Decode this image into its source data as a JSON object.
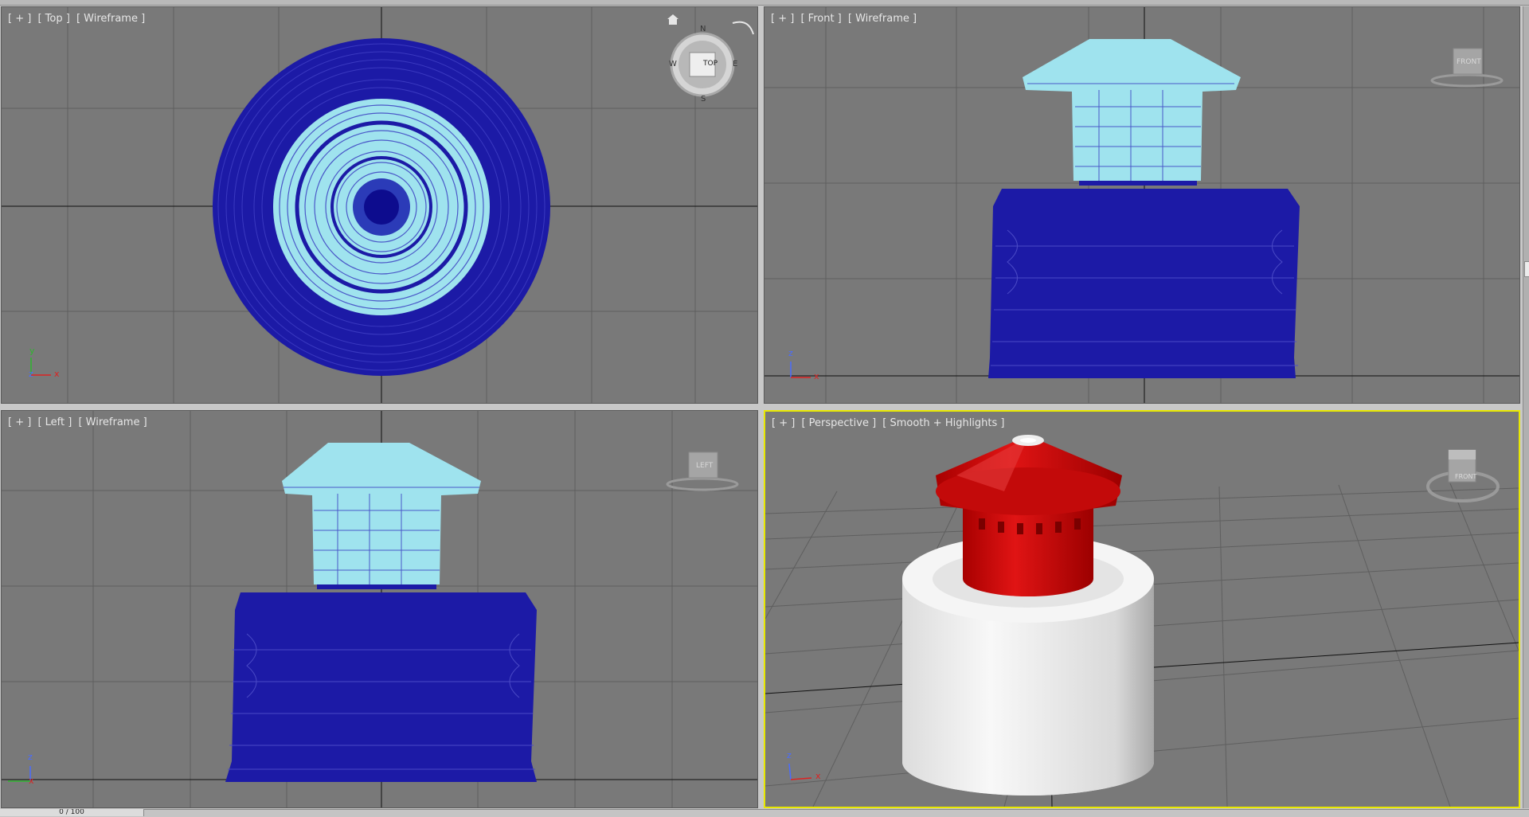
{
  "viewports": {
    "top": {
      "plus": "[ + ]",
      "view": "[ Top ]",
      "mode": "[ Wireframe ]"
    },
    "front": {
      "plus": "[ + ]",
      "view": "[ Front ]",
      "mode": "[ Wireframe ]"
    },
    "left": {
      "plus": "[ + ]",
      "view": "[ Left ]",
      "mode": "[ Wireframe ]"
    },
    "perspective": {
      "plus": "[ + ]",
      "view": "[ Perspective ]",
      "mode": "[ Smooth + Highlights ]"
    }
  },
  "viewcube": {
    "top_face": "TOP",
    "front_face": "FRONT",
    "left_face": "LEFT",
    "compass": {
      "n": "N",
      "s": "S",
      "e": "E",
      "w": "W"
    }
  },
  "axes": {
    "x": "x",
    "y": "y",
    "z": "z"
  },
  "timeslider": {
    "label": "0 / 100"
  },
  "colors": {
    "viewport_bg": "#797979",
    "grid": "#5e5e5e",
    "grid_axis": "#101010",
    "wire_dark": "#1c1aa6",
    "wire_light": "#9fe3ee",
    "active_border": "#e8e800",
    "cap_red": "#cc0e0e",
    "body_white": "#f2f2f2"
  },
  "icons": [
    "home-icon",
    "orbit-arrow-icon",
    "viewcube-icon"
  ]
}
